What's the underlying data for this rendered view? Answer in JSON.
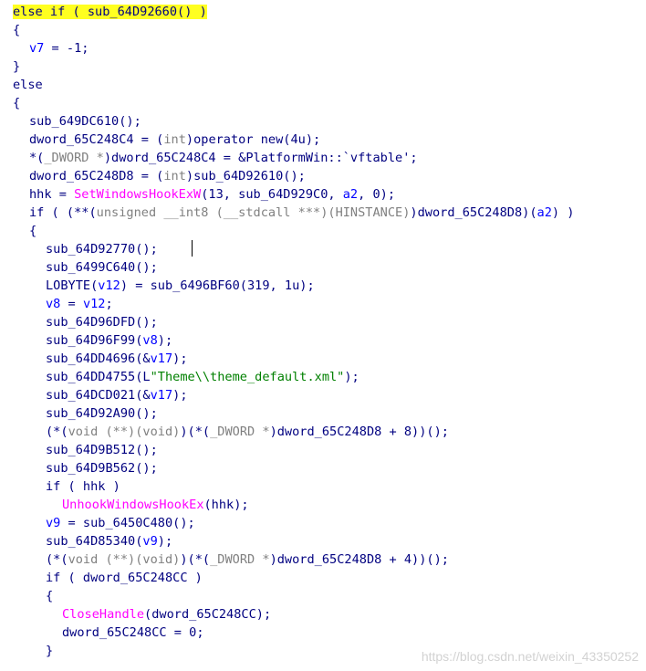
{
  "colors": {
    "plain": "#000080",
    "variable": "#0000ff",
    "type": "#808080",
    "string": "#008000",
    "import_func": "#ff00ff",
    "highlight": "#ffff20"
  },
  "code_lines": [
    {
      "indent": 0,
      "highlight": true,
      "tokens": [
        {
          "t": "else if ( sub_64D92660() )",
          "c": "plain"
        }
      ]
    },
    {
      "indent": 0,
      "tokens": [
        {
          "t": "{",
          "c": "plain"
        }
      ]
    },
    {
      "indent": 1,
      "tokens": [
        {
          "t": "v7",
          "c": "variable"
        },
        {
          "t": " = -1;",
          "c": "plain"
        }
      ]
    },
    {
      "indent": 0,
      "tokens": [
        {
          "t": "}",
          "c": "plain"
        }
      ]
    },
    {
      "indent": 0,
      "tokens": [
        {
          "t": "else",
          "c": "plain"
        }
      ]
    },
    {
      "indent": 0,
      "tokens": [
        {
          "t": "{",
          "c": "plain"
        }
      ]
    },
    {
      "indent": 1,
      "tokens": [
        {
          "t": "sub_649DC610();",
          "c": "plain"
        }
      ]
    },
    {
      "indent": 1,
      "tokens": [
        {
          "t": "dword_65C248C4 = (",
          "c": "plain"
        },
        {
          "t": "int",
          "c": "type"
        },
        {
          "t": ")operator new(4u);",
          "c": "plain"
        }
      ]
    },
    {
      "indent": 1,
      "tokens": [
        {
          "t": "*(",
          "c": "plain"
        },
        {
          "t": "_DWORD *",
          "c": "type"
        },
        {
          "t": ")dword_65C248C4 = &PlatformWin::`vftable';",
          "c": "plain"
        }
      ]
    },
    {
      "indent": 1,
      "tokens": [
        {
          "t": "dword_65C248D8 = (",
          "c": "plain"
        },
        {
          "t": "int",
          "c": "type"
        },
        {
          "t": ")sub_64D92610();",
          "c": "plain"
        }
      ]
    },
    {
      "indent": 1,
      "tokens": [
        {
          "t": "hhk = ",
          "c": "plain"
        },
        {
          "t": "SetWindowsHookExW",
          "c": "import_func"
        },
        {
          "t": "(13, sub_64D929C0, ",
          "c": "plain"
        },
        {
          "t": "a2",
          "c": "variable"
        },
        {
          "t": ", 0);",
          "c": "plain"
        }
      ]
    },
    {
      "indent": 1,
      "tokens": [
        {
          "t": "if ( (**(",
          "c": "plain"
        },
        {
          "t": "unsigned __int8 (__stdcall ***)(HINSTANCE)",
          "c": "type"
        },
        {
          "t": ")dword_65C248D8)(",
          "c": "plain"
        },
        {
          "t": "a2",
          "c": "variable"
        },
        {
          "t": ") )",
          "c": "plain"
        }
      ]
    },
    {
      "indent": 1,
      "tokens": [
        {
          "t": "{",
          "c": "plain"
        }
      ]
    },
    {
      "indent": 2,
      "tokens": [
        {
          "t": "sub_64D92770();",
          "c": "plain"
        }
      ]
    },
    {
      "indent": 2,
      "tokens": [
        {
          "t": "sub_6499C640();",
          "c": "plain"
        }
      ]
    },
    {
      "indent": 2,
      "tokens": [
        {
          "t": "LOBYTE(",
          "c": "plain"
        },
        {
          "t": "v12",
          "c": "variable"
        },
        {
          "t": ") = sub_6496BF60(319, 1u);",
          "c": "plain"
        }
      ]
    },
    {
      "indent": 2,
      "tokens": [
        {
          "t": "v8",
          "c": "variable"
        },
        {
          "t": " = ",
          "c": "plain"
        },
        {
          "t": "v12",
          "c": "variable"
        },
        {
          "t": ";",
          "c": "plain"
        }
      ]
    },
    {
      "indent": 2,
      "tokens": [
        {
          "t": "sub_64D96DFD();",
          "c": "plain"
        }
      ]
    },
    {
      "indent": 2,
      "tokens": [
        {
          "t": "sub_64D96F99(",
          "c": "plain"
        },
        {
          "t": "v8",
          "c": "variable"
        },
        {
          "t": ");",
          "c": "plain"
        }
      ]
    },
    {
      "indent": 2,
      "tokens": [
        {
          "t": "sub_64DD4696(&",
          "c": "plain"
        },
        {
          "t": "v17",
          "c": "variable"
        },
        {
          "t": ");",
          "c": "plain"
        }
      ]
    },
    {
      "indent": 2,
      "tokens": [
        {
          "t": "sub_64DD4755(L",
          "c": "plain"
        },
        {
          "t": "\"Theme\\\\theme_default.xml\"",
          "c": "string"
        },
        {
          "t": ");",
          "c": "plain"
        }
      ]
    },
    {
      "indent": 2,
      "tokens": [
        {
          "t": "sub_64DCD021(&",
          "c": "plain"
        },
        {
          "t": "v17",
          "c": "variable"
        },
        {
          "t": ");",
          "c": "plain"
        }
      ]
    },
    {
      "indent": 2,
      "tokens": [
        {
          "t": "sub_64D92A90();",
          "c": "plain"
        }
      ]
    },
    {
      "indent": 2,
      "tokens": [
        {
          "t": "(*(",
          "c": "plain"
        },
        {
          "t": "void (**)(void)",
          "c": "type"
        },
        {
          "t": ")(*(",
          "c": "plain"
        },
        {
          "t": "_DWORD *",
          "c": "type"
        },
        {
          "t": ")dword_65C248D8 + 8))();",
          "c": "plain"
        }
      ]
    },
    {
      "indent": 2,
      "tokens": [
        {
          "t": "sub_64D9B512();",
          "c": "plain"
        }
      ]
    },
    {
      "indent": 2,
      "tokens": [
        {
          "t": "sub_64D9B562();",
          "c": "plain"
        }
      ]
    },
    {
      "indent": 2,
      "tokens": [
        {
          "t": "if ( hhk )",
          "c": "plain"
        }
      ]
    },
    {
      "indent": 3,
      "tokens": [
        {
          "t": "UnhookWindowsHookEx",
          "c": "import_func"
        },
        {
          "t": "(hhk);",
          "c": "plain"
        }
      ]
    },
    {
      "indent": 2,
      "tokens": [
        {
          "t": "v9",
          "c": "variable"
        },
        {
          "t": " = sub_6450C480();",
          "c": "plain"
        }
      ]
    },
    {
      "indent": 2,
      "tokens": [
        {
          "t": "sub_64D85340(",
          "c": "plain"
        },
        {
          "t": "v9",
          "c": "variable"
        },
        {
          "t": ");",
          "c": "plain"
        }
      ]
    },
    {
      "indent": 2,
      "tokens": [
        {
          "t": "(*(",
          "c": "plain"
        },
        {
          "t": "void (**)(void)",
          "c": "type"
        },
        {
          "t": ")(*(",
          "c": "plain"
        },
        {
          "t": "_DWORD *",
          "c": "type"
        },
        {
          "t": ")dword_65C248D8 + 4))();",
          "c": "plain"
        }
      ]
    },
    {
      "indent": 2,
      "tokens": [
        {
          "t": "if ( dword_65C248CC )",
          "c": "plain"
        }
      ]
    },
    {
      "indent": 2,
      "tokens": [
        {
          "t": "{",
          "c": "plain"
        }
      ]
    },
    {
      "indent": 3,
      "tokens": [
        {
          "t": "CloseHandle",
          "c": "import_func"
        },
        {
          "t": "(dword_65C248CC);",
          "c": "plain"
        }
      ]
    },
    {
      "indent": 3,
      "tokens": [
        {
          "t": "dword_65C248CC = 0;",
          "c": "plain"
        }
      ]
    },
    {
      "indent": 2,
      "tokens": [
        {
          "t": "}",
          "c": "plain"
        }
      ]
    }
  ],
  "watermark": "https://blog.csdn.net/weixin_43350252"
}
